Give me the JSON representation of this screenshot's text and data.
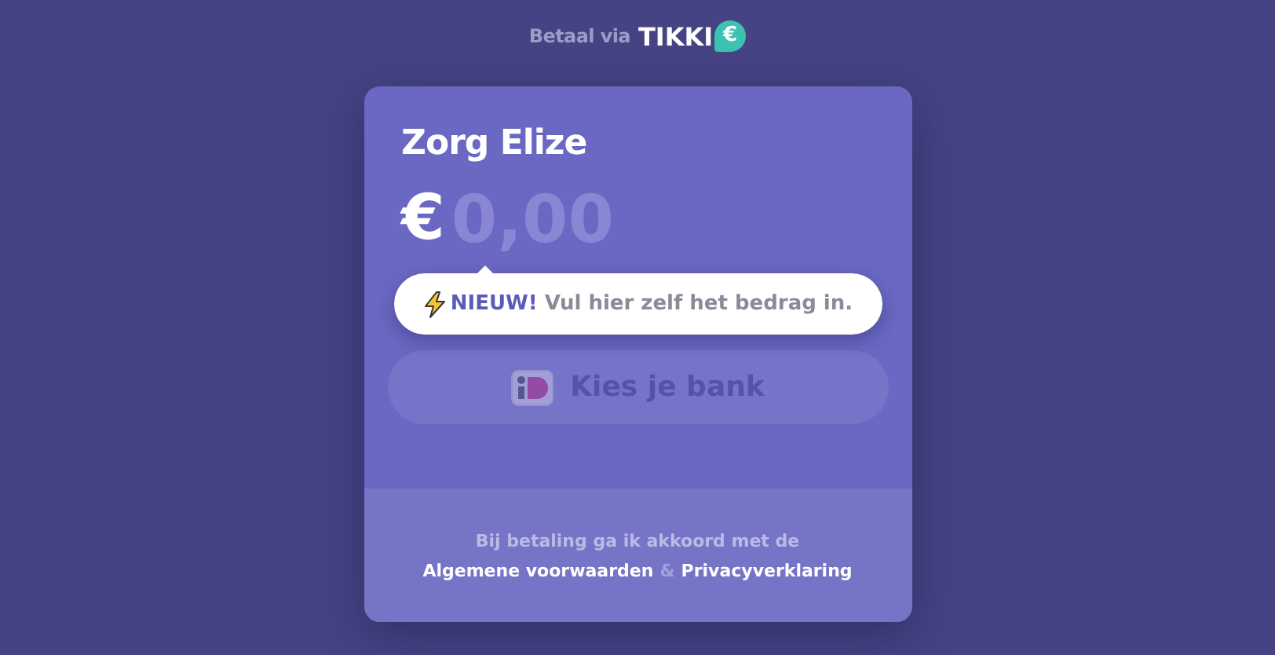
{
  "header": {
    "label": "Betaal via",
    "logo": "TIKKI",
    "logo_badge": "€"
  },
  "card": {
    "title": "Zorg Elize",
    "currency": "€",
    "amount": {
      "placeholder": "0,00"
    },
    "tooltip": {
      "text": "**NIEUW!** Vul hier zelf het bedrag in."
    },
    "bank_button": {
      "label": "Kies je bank",
      "disabled": true
    }
  },
  "footer": {
    "text": "Bij betaling ga ik akkoord met de",
    "links": [
      "Algemene voorwaarden",
      "Privacyverklaring"
    ],
    "separator": "&"
  }
}
